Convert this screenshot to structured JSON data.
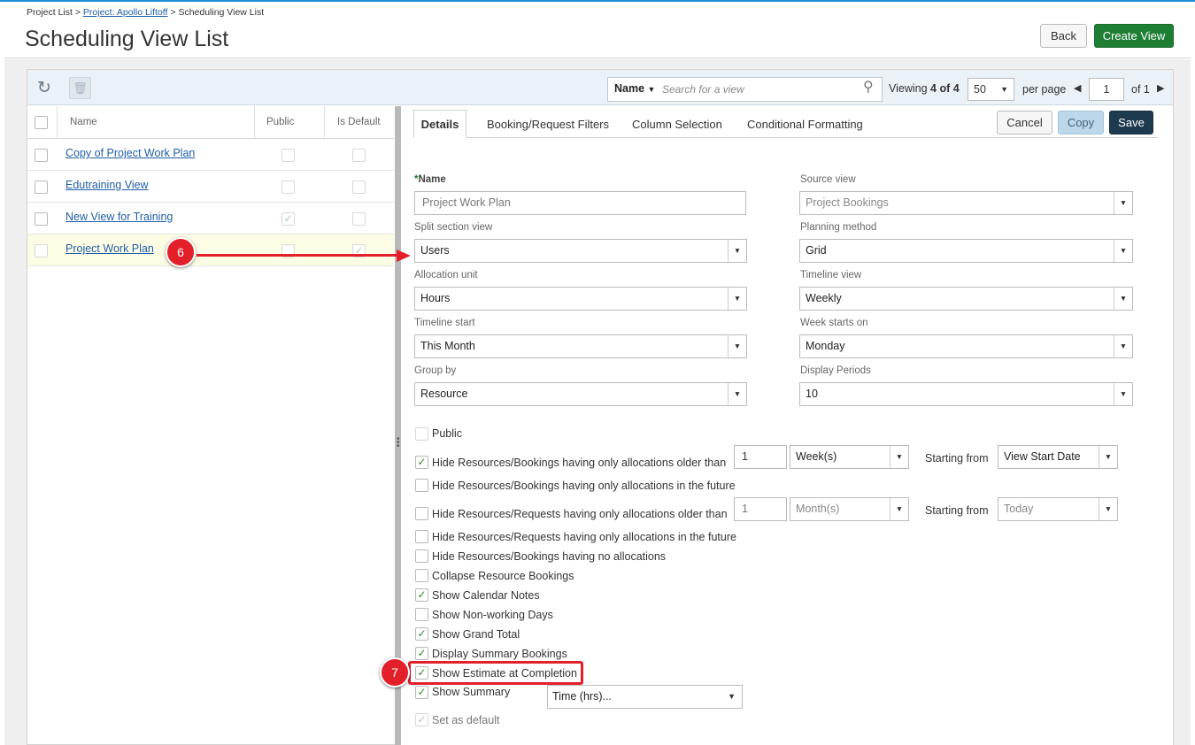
{
  "breadcrumb": {
    "project_list": "Project List",
    "separator": ">",
    "project": "Project: Apollo Liftoff",
    "current": "Scheduling View List"
  },
  "page": {
    "title": "Scheduling View List"
  },
  "header_buttons": {
    "back": "Back",
    "create_view": "Create View"
  },
  "toolbar": {
    "search_field": "Name",
    "search_placeholder": "Search for a view",
    "viewing_prefix": "Viewing",
    "viewing_count": "4 of 4",
    "page_size": "50",
    "per_page": "per page",
    "page_number": "1",
    "of_pages": "of 1"
  },
  "list": {
    "columns": {
      "name": "Name",
      "public": "Public",
      "is_default": "Is Default"
    },
    "rows": [
      {
        "name": "Copy of Project Work Plan",
        "public": false,
        "is_default": false
      },
      {
        "name": "Edutraining View",
        "public": false,
        "is_default": false
      },
      {
        "name": "New View for Training",
        "public": true,
        "is_default": false
      },
      {
        "name": "Project Work Plan",
        "public": false,
        "is_default": true,
        "selected": true
      }
    ]
  },
  "tabs": {
    "details": "Details",
    "booking_request_filters": "Booking/Request Filters",
    "column_selection": "Column Selection",
    "conditional_formatting": "Conditional Formatting"
  },
  "form_buttons": {
    "cancel": "Cancel",
    "copy": "Copy",
    "save": "Save"
  },
  "form": {
    "name_label": "Name",
    "name_required": "*",
    "name_value": "Project Work Plan",
    "source_view_label": "Source view",
    "source_view_value": "Project Bookings",
    "split_section_label": "Split section view",
    "split_section_value": "Users",
    "planning_method_label": "Planning method",
    "planning_method_value": "Grid",
    "allocation_unit_label": "Allocation unit",
    "allocation_unit_value": "Hours",
    "timeline_view_label": "Timeline view",
    "timeline_view_value": "Weekly",
    "timeline_start_label": "Timeline start",
    "timeline_start_value": "This Month",
    "week_starts_label": "Week starts on",
    "week_starts_value": "Monday",
    "group_by_label": "Group by",
    "group_by_value": "Resource",
    "display_periods_label": "Display Periods",
    "display_periods_value": "10"
  },
  "options": {
    "public": {
      "label": "Public",
      "checked": false
    },
    "hide_bookings_older": {
      "label": "Hide Resources/Bookings having only allocations older than",
      "checked": true,
      "amount": "1",
      "unit": "Week(s)",
      "starting_label": "Starting from",
      "starting_value": "View Start Date"
    },
    "hide_bookings_future": {
      "label": "Hide Resources/Bookings having only allocations in the future",
      "checked": false
    },
    "hide_requests_older": {
      "label": "Hide Resources/Requests having only allocations older than",
      "checked": false,
      "amount": "1",
      "unit": "Month(s)",
      "starting_label": "Starting from",
      "starting_value": "Today"
    },
    "hide_requests_future": {
      "label": "Hide Resources/Requests having only allocations in the future",
      "checked": false
    },
    "hide_no_allocations": {
      "label": "Hide Resources/Bookings having no allocations",
      "checked": false
    },
    "collapse_bookings": {
      "label": "Collapse Resource Bookings",
      "checked": false
    },
    "show_calendar_notes": {
      "label": "Show Calendar Notes",
      "checked": true
    },
    "show_non_working": {
      "label": "Show Non-working Days",
      "checked": false
    },
    "show_grand_total": {
      "label": "Show Grand Total",
      "checked": true
    },
    "display_summary_bookings": {
      "label": "Display Summary Bookings",
      "checked": true
    },
    "show_estimate_completion": {
      "label": "Show Estimate at Completion",
      "checked": true
    },
    "show_summary": {
      "label": "Show Summary",
      "checked": true,
      "value": "Time (hrs)..."
    },
    "set_default": {
      "label": "Set as default",
      "checked": true
    }
  },
  "callouts": {
    "step6": "6",
    "step7": "7"
  },
  "colors": {
    "accent_green": "#1e7e34",
    "save_navy": "#1d3a4f",
    "link_blue": "#1f5ea8",
    "callout_red": "#e3202a"
  }
}
